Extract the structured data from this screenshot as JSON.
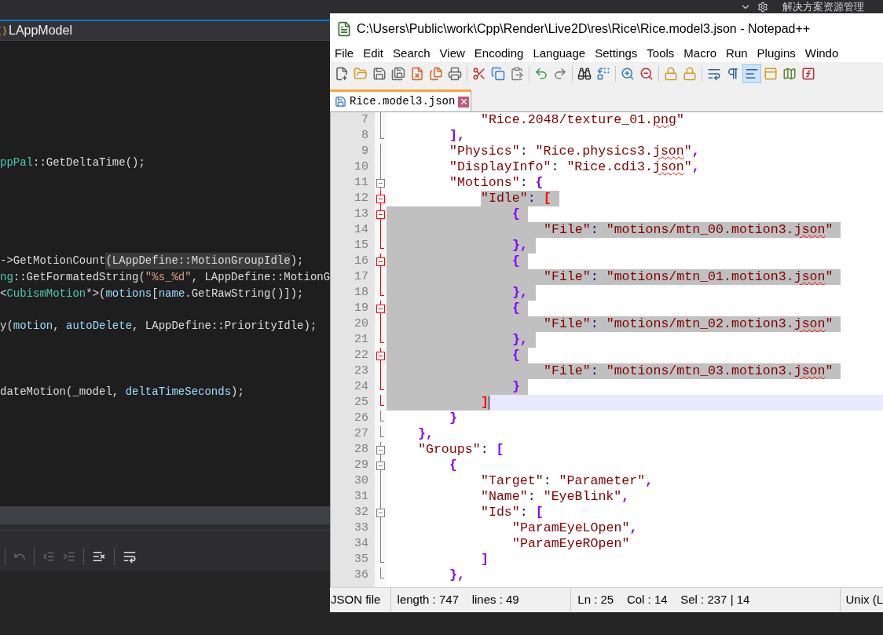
{
  "ide": {
    "top_bar": {
      "panel_title": "解决方案资源管理"
    },
    "tab": {
      "label": "LAppModel"
    },
    "code_lines": [
      {
        "kind": "blank"
      },
      {
        "kind": "blank"
      },
      {
        "kind": "blank"
      },
      {
        "kind": "blank"
      },
      {
        "kind": "blank"
      },
      {
        "kind": "blank"
      },
      {
        "kind": "blank"
      },
      {
        "kind": "code",
        "tokens": [
          {
            "t": "ppPal",
            "kind": "type"
          },
          {
            "t": "::GetDeltaTime();",
            "kind": "plain"
          }
        ]
      },
      {
        "kind": "blank"
      },
      {
        "kind": "blank"
      },
      {
        "kind": "blank"
      },
      {
        "kind": "blank"
      },
      {
        "kind": "blank"
      },
      {
        "kind": "code",
        "tokens": [
          {
            "t": "->GetMotionCount",
            "kind": "plain"
          },
          {
            "t": "(LAppDefine::MotionGroupIdle",
            "kind": "plain",
            "highlighted": true
          },
          {
            "t": ");",
            "kind": "plain"
          }
        ]
      },
      {
        "kind": "code",
        "tokens": [
          {
            "t": "ng",
            "kind": "type"
          },
          {
            "t": "::GetFormatedString(",
            "kind": "plain"
          },
          {
            "t": "\"%s_%d\"",
            "kind": "string"
          },
          {
            "t": ", LAppDefine::MotionG",
            "kind": "plain"
          }
        ]
      },
      {
        "kind": "code",
        "tokens": [
          {
            "t": "<",
            "kind": "plain"
          },
          {
            "t": "CubismMotion",
            "kind": "type"
          },
          {
            "t": "*>(",
            "kind": "plain"
          },
          {
            "t": "motions",
            "kind": "var"
          },
          {
            "t": "[",
            "kind": "plain"
          },
          {
            "t": "name",
            "kind": "var"
          },
          {
            "t": ".GetRawString()]);",
            "kind": "plain"
          }
        ]
      },
      {
        "kind": "blank"
      },
      {
        "kind": "code",
        "tokens": [
          {
            "t": "y(",
            "kind": "plain"
          },
          {
            "t": "motion",
            "kind": "var"
          },
          {
            "t": ", ",
            "kind": "plain"
          },
          {
            "t": "autoDelete",
            "kind": "var"
          },
          {
            "t": ", LAppDefine::PriorityIdle);",
            "kind": "plain"
          }
        ]
      },
      {
        "kind": "blank"
      },
      {
        "kind": "blank"
      },
      {
        "kind": "blank"
      },
      {
        "kind": "code",
        "tokens": [
          {
            "t": "dateMotion(_model, ",
            "kind": "plain"
          },
          {
            "t": "deltaTimeSeconds",
            "kind": "var"
          },
          {
            "t": ");",
            "kind": "plain"
          }
        ]
      }
    ]
  },
  "notepad": {
    "title": "C:\\Users\\Public\\work\\Cpp\\Render\\Live2D\\res\\Rice\\Rice.model3.json - Notepad++",
    "menu": [
      "File",
      "Edit",
      "Search",
      "View",
      "Encoding",
      "Language",
      "Settings",
      "Tools",
      "Macro",
      "Run",
      "Plugins",
      "Windo"
    ],
    "toolbar_toggles": {
      "word_wrap": false,
      "show_all_characters": false,
      "indent_guide": true
    },
    "tabs": [
      {
        "label": "Rice.model3.json",
        "selected": true
      }
    ],
    "lines": [
      {
        "number": "7",
        "active_block": false,
        "current": false,
        "selected": false,
        "tokens": [
          {
            "t": "\"Rice.2048/texture_01.",
            "kind": "string"
          },
          {
            "t": "png",
            "kind": "string",
            "misspelled": true
          },
          {
            "t": "\"",
            "kind": "string"
          }
        ]
      },
      {
        "number": "8",
        "fold_end": true,
        "active_block": false,
        "current": false,
        "selected": false,
        "tokens": [
          {
            "t": "],",
            "kind": "delim"
          }
        ]
      },
      {
        "number": "9",
        "active_block": false,
        "current": false,
        "selected": false,
        "tokens": [
          {
            "t": "\"Physics\"",
            "kind": "string"
          },
          {
            "t": ": ",
            "kind": "op"
          },
          {
            "t": "\"Rice.physics3.",
            "kind": "string"
          },
          {
            "t": "json",
            "kind": "string",
            "misspelled": true
          },
          {
            "t": "\"",
            "kind": "string"
          },
          {
            "t": ",",
            "kind": "delim"
          }
        ]
      },
      {
        "number": "10",
        "active_block": false,
        "current": false,
        "selected": false,
        "tokens": [
          {
            "t": "\"DisplayInfo\"",
            "kind": "string"
          },
          {
            "t": ": ",
            "kind": "op"
          },
          {
            "t": "\"Rice.cdi3.",
            "kind": "string"
          },
          {
            "t": "json",
            "kind": "string",
            "misspelled": true
          },
          {
            "t": "\"",
            "kind": "string"
          },
          {
            "t": ",",
            "kind": "delim"
          }
        ]
      },
      {
        "number": "11",
        "fold_toggle": true,
        "active_block": false,
        "current": false,
        "selected": false,
        "tokens": [
          {
            "t": "\"Motions\"",
            "kind": "string"
          },
          {
            "t": ": ",
            "kind": "op"
          },
          {
            "t": "{",
            "kind": "delim"
          }
        ]
      },
      {
        "number": "12",
        "fold_toggle": true,
        "active_block": true,
        "current": false,
        "selected": true,
        "tokens": [
          {
            "t": "\"Idle\"",
            "kind": "string"
          },
          {
            "t": ": ",
            "kind": "op"
          },
          {
            "t": "[",
            "kind": "match"
          }
        ]
      },
      {
        "number": "13",
        "fold_toggle": true,
        "active_block": true,
        "current": false,
        "selected": true,
        "tokens": [
          {
            "t": "{",
            "kind": "delim"
          }
        ]
      },
      {
        "number": "14",
        "active_block": true,
        "current": false,
        "selected": true,
        "tokens": [
          {
            "t": "\"File\"",
            "kind": "string"
          },
          {
            "t": ": ",
            "kind": "op"
          },
          {
            "t": "\"motions/mtn_00.motion3.",
            "kind": "string"
          },
          {
            "t": "json",
            "kind": "string",
            "misspelled": true
          },
          {
            "t": "\"",
            "kind": "string"
          }
        ]
      },
      {
        "number": "15",
        "fold_end": true,
        "active_block": true,
        "current": false,
        "selected": true,
        "tokens": [
          {
            "t": "},",
            "kind": "delim"
          }
        ]
      },
      {
        "number": "16",
        "fold_toggle": true,
        "active_block": true,
        "current": false,
        "selected": true,
        "tokens": [
          {
            "t": "{",
            "kind": "delim"
          }
        ]
      },
      {
        "number": "17",
        "active_block": true,
        "current": false,
        "selected": true,
        "tokens": [
          {
            "t": "\"File\"",
            "kind": "string"
          },
          {
            "t": ": ",
            "kind": "op"
          },
          {
            "t": "\"motions/mtn_01.motion3.",
            "kind": "string"
          },
          {
            "t": "json",
            "kind": "string",
            "misspelled": true
          },
          {
            "t": "\"",
            "kind": "string"
          }
        ]
      },
      {
        "number": "18",
        "fold_end": true,
        "active_block": true,
        "current": false,
        "selected": true,
        "tokens": [
          {
            "t": "},",
            "kind": "delim"
          }
        ]
      },
      {
        "number": "19",
        "fold_toggle": true,
        "active_block": true,
        "current": false,
        "selected": true,
        "tokens": [
          {
            "t": "{",
            "kind": "delim"
          }
        ]
      },
      {
        "number": "20",
        "active_block": true,
        "current": false,
        "selected": true,
        "tokens": [
          {
            "t": "\"File\"",
            "kind": "string"
          },
          {
            "t": ": ",
            "kind": "op"
          },
          {
            "t": "\"motions/mtn_02.motion3.",
            "kind": "string"
          },
          {
            "t": "json",
            "kind": "string",
            "misspelled": true
          },
          {
            "t": "\"",
            "kind": "string"
          }
        ]
      },
      {
        "number": "21",
        "fold_end": true,
        "active_block": true,
        "current": false,
        "selected": true,
        "tokens": [
          {
            "t": "},",
            "kind": "delim"
          }
        ]
      },
      {
        "number": "22",
        "fold_toggle": true,
        "active_block": true,
        "current": false,
        "selected": true,
        "tokens": [
          {
            "t": "{",
            "kind": "delim"
          }
        ]
      },
      {
        "number": "23",
        "active_block": true,
        "current": false,
        "selected": true,
        "tokens": [
          {
            "t": "\"File\"",
            "kind": "string"
          },
          {
            "t": ": ",
            "kind": "op"
          },
          {
            "t": "\"motions/mtn_03.motion3.",
            "kind": "string"
          },
          {
            "t": "json",
            "kind": "string",
            "misspelled": true
          },
          {
            "t": "\"",
            "kind": "string"
          }
        ]
      },
      {
        "number": "24",
        "fold_end": true,
        "active_block": true,
        "current": false,
        "selected": true,
        "tokens": [
          {
            "t": "}",
            "kind": "delim"
          }
        ]
      },
      {
        "number": "25",
        "fold_end": true,
        "active_block": true,
        "current": true,
        "selected": true,
        "tokens": [
          {
            "t": "]",
            "kind": "match"
          }
        ]
      },
      {
        "number": "26",
        "fold_end": true,
        "active_block": false,
        "current": false,
        "selected": false,
        "tokens": [
          {
            "t": "}",
            "kind": "delim"
          }
        ]
      },
      {
        "number": "27",
        "fold_end": true,
        "active_block": false,
        "current": false,
        "selected": false,
        "tokens": [
          {
            "t": "},",
            "kind": "delim"
          }
        ]
      },
      {
        "number": "28",
        "fold_toggle": true,
        "active_block": false,
        "current": false,
        "selected": false,
        "tokens": [
          {
            "t": "\"Groups\"",
            "kind": "string"
          },
          {
            "t": ": ",
            "kind": "op"
          },
          {
            "t": "[",
            "kind": "delim"
          }
        ]
      },
      {
        "number": "29",
        "fold_toggle": true,
        "active_block": false,
        "current": false,
        "selected": false,
        "tokens": [
          {
            "t": "{",
            "kind": "delim"
          }
        ]
      },
      {
        "number": "30",
        "active_block": false,
        "current": false,
        "selected": false,
        "tokens": [
          {
            "t": "\"Target\"",
            "kind": "string"
          },
          {
            "t": ": ",
            "kind": "op"
          },
          {
            "t": "\"Parameter\"",
            "kind": "string"
          },
          {
            "t": ",",
            "kind": "delim"
          }
        ]
      },
      {
        "number": "31",
        "active_block": false,
        "current": false,
        "selected": false,
        "tokens": [
          {
            "t": "\"Name\"",
            "kind": "string"
          },
          {
            "t": ": ",
            "kind": "op"
          },
          {
            "t": "\"EyeBlink\"",
            "kind": "string"
          },
          {
            "t": ",",
            "kind": "delim"
          }
        ]
      },
      {
        "number": "32",
        "fold_toggle": true,
        "active_block": false,
        "current": false,
        "selected": false,
        "tokens": [
          {
            "t": "\"Ids\"",
            "kind": "string"
          },
          {
            "t": ": ",
            "kind": "op"
          },
          {
            "t": "[",
            "kind": "delim"
          }
        ]
      },
      {
        "number": "33",
        "active_block": false,
        "current": false,
        "selected": false,
        "tokens": [
          {
            "t": "\"ParamEyeLOpen\"",
            "kind": "string"
          },
          {
            "t": ",",
            "kind": "delim"
          }
        ]
      },
      {
        "number": "34",
        "active_block": false,
        "current": false,
        "selected": false,
        "tokens": [
          {
            "t": "\"ParamEyeROpen\"",
            "kind": "string"
          }
        ]
      },
      {
        "number": "35",
        "fold_end": true,
        "active_block": false,
        "current": false,
        "selected": false,
        "tokens": [
          {
            "t": "]",
            "kind": "delim"
          }
        ]
      },
      {
        "number": "36",
        "fold_end": true,
        "active_block": false,
        "current": false,
        "selected": false,
        "tokens": [
          {
            "t": "},",
            "kind": "delim"
          }
        ]
      }
    ],
    "status_bar": [
      "JSON file",
      "length : 747    lines : 49",
      "Ln : 25    Col : 14    Sel : 237 | 14",
      "Unix (L"
    ]
  }
}
